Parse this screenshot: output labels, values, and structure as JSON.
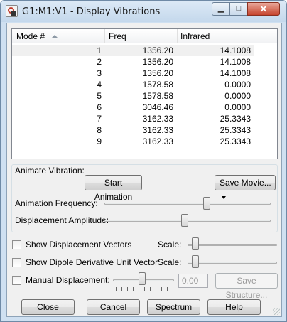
{
  "window": {
    "title": "G1:M1:V1 - Display Vibrations",
    "controls": {
      "minimize": "▁",
      "maximize": "□",
      "close": "✕"
    }
  },
  "table": {
    "headers": [
      "Mode #",
      "Freq",
      "Infrared"
    ],
    "rows": [
      [
        "1",
        "1356.20",
        "14.1008"
      ],
      [
        "2",
        "1356.20",
        "14.1008"
      ],
      [
        "3",
        "1356.20",
        "14.1008"
      ],
      [
        "4",
        "1578.58",
        "0.0000"
      ],
      [
        "5",
        "1578.58",
        "0.0000"
      ],
      [
        "6",
        "3046.46",
        "0.0000"
      ],
      [
        "7",
        "3162.33",
        "25.3343"
      ],
      [
        "8",
        "3162.33",
        "25.3343"
      ],
      [
        "9",
        "3162.33",
        "25.3343"
      ]
    ],
    "selected_row": 0
  },
  "animate": {
    "title": "Animate Vibration:",
    "start_label": "Start Animation",
    "save_movie_label": "Save Movie...",
    "frequency_label": "Animation Frequency:",
    "frequency_level": 0.62,
    "amplitude_label": "Displacement Amplitude:",
    "amplitude_level": 0.48
  },
  "options": {
    "show_vectors_label": "Show Displacement Vectors",
    "show_dipole_label": "Show Dipole Derivative Unit Vector",
    "manual_label": "Manual Displacement:",
    "scale_label": "Scale:",
    "scale1_level": 0.05,
    "scale2_level": 0.05,
    "manual_level": 0.47,
    "manual_value": "0.00",
    "save_structure_label": "Save Structure..."
  },
  "buttons": {
    "close": "Close",
    "cancel": "Cancel",
    "spectrum": "Spectrum",
    "help": "Help"
  },
  "icons": [
    "app-icon",
    "sort-up-icon",
    "dropdown-caret-icon",
    "resize-grip-icon"
  ]
}
